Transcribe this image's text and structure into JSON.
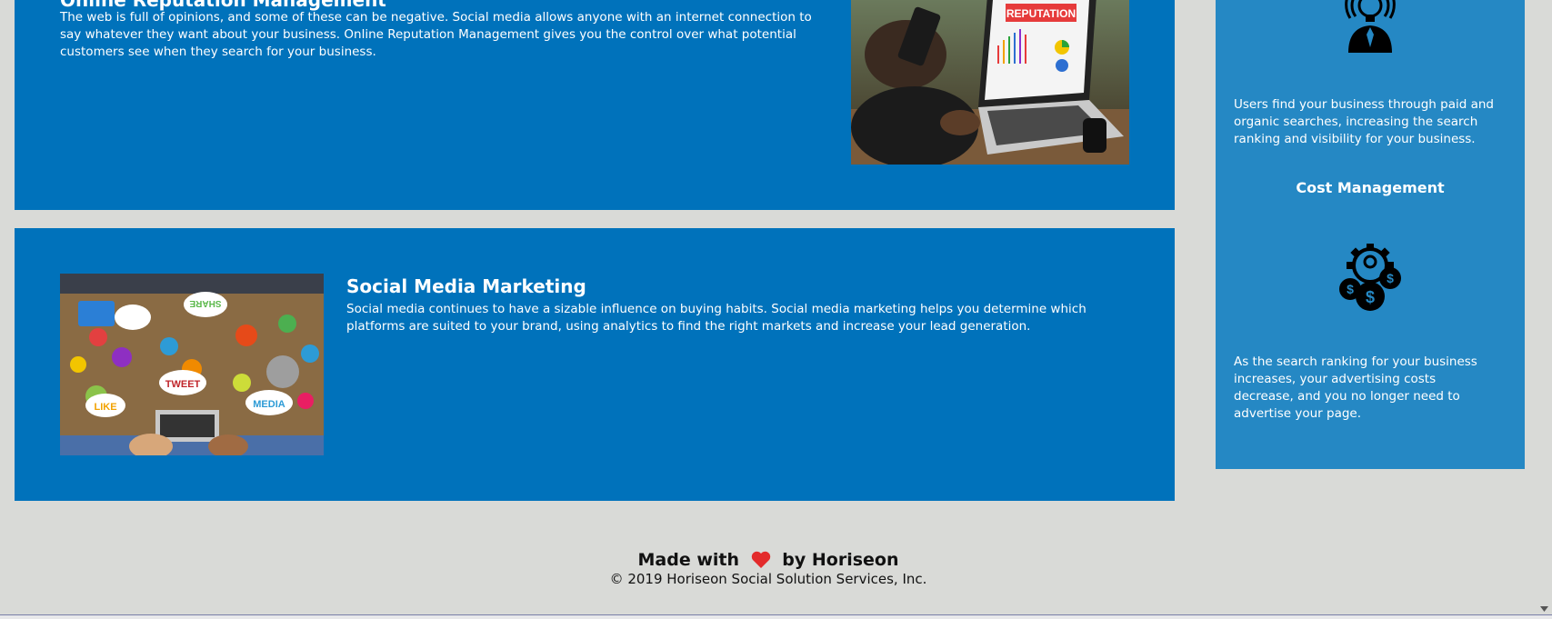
{
  "sections": {
    "reputation": {
      "title": "Online Reputation Management",
      "body": "The web is full of opinions, and some of these can be negative. Social media allows anyone with an internet connection to say whatever they want about your business. Online Reputation Management gives you the control over what potential customers see when they search for your business.",
      "image_label": "REPUTATION"
    },
    "social": {
      "title": "Social Media Marketing",
      "body": "Social media continues to have a sizable influence on buying habits. Social media marketing helps you determine which platforms are suited to your brand, using analytics to find the right markets and increase your lead generation.",
      "bubbles": [
        "SHARE",
        "TWEET",
        "LIKE",
        "MEDIA"
      ]
    }
  },
  "sidebar": {
    "lead_text": "Users find your business through paid and organic searches, increasing the search ranking and visibility for your business.",
    "cost_title": "Cost Management",
    "cost_text": "As the search ranking for your business increases, your advertising costs decrease, and you no longer need to advertise your page.",
    "icons": [
      "lightbulb-person-icon",
      "gear-dollar-icon"
    ]
  },
  "footer": {
    "made_with": "Made with",
    "by": "by Horiseon",
    "copyright": "© 2019 Horiseon Social Solution Services, Inc."
  },
  "colors": {
    "panel": "#0072bb",
    "sidebar": "#2588c4",
    "background": "#d9dad7",
    "heart": "#e32b2b"
  }
}
